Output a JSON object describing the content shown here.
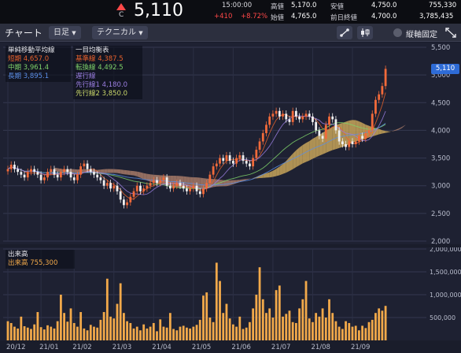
{
  "header": {
    "price_prefix": "C",
    "price": "5,110",
    "time": "15:00:00",
    "change": "+410",
    "change_pct": "+8.72%",
    "stats": [
      {
        "label": "高値",
        "value": "5,170.0"
      },
      {
        "label": "安値",
        "value": "4,750.0"
      },
      {
        "label": "",
        "value": "755,330"
      },
      {
        "label": "始値",
        "value": "4,765.0"
      },
      {
        "label": "前日終値",
        "value": "4,700.0"
      },
      {
        "label": "",
        "value": "3,785,435"
      }
    ]
  },
  "toolbar": {
    "title": "チャート",
    "period": "日足",
    "indicator": "テクニカル",
    "toggle_label": "縦軸固定"
  },
  "legend_sma": {
    "title": "単純移動平均線",
    "items": [
      {
        "name": "短期",
        "value": "4,657.0",
        "color": "#e8612c"
      },
      {
        "name": "中期",
        "value": "3,961.4",
        "color": "#7fd36a"
      },
      {
        "name": "長期",
        "value": "3,895.1",
        "color": "#5b8ee6"
      }
    ]
  },
  "legend_ichimoku": {
    "title": "一目均衡表",
    "items": [
      {
        "name": "基準線",
        "value": "4,387.5",
        "color": "#e8612c"
      },
      {
        "name": "転換線",
        "value": "4,492.5",
        "color": "#7fd36a"
      },
      {
        "name": "遅行線",
        "value": "",
        "color": "#9a7ee0"
      },
      {
        "name": "先行線1",
        "value": "4,180.0",
        "color": "#9a7ee0"
      },
      {
        "name": "先行線2",
        "value": "3,850.0",
        "color": "#c9d76a"
      }
    ]
  },
  "legend_volume": {
    "title": "出来高",
    "items": [
      {
        "name": "出来高",
        "value": "755,300",
        "color": "#f2a94a"
      }
    ]
  },
  "price_axis_labels": [
    "5,500",
    "5,000",
    "4,500",
    "4,000",
    "3,500",
    "3,000",
    "2,500",
    "2,000"
  ],
  "current_price_tag": "5,110",
  "volume_axis_labels": [
    "2,000,000",
    "1,500,000",
    "1,000,000",
    "500,000"
  ],
  "x_axis_labels": [
    "20/12",
    "21/01",
    "21/02",
    "21/03",
    "21/04",
    "21/05",
    "21/06",
    "21/07",
    "21/08",
    "21/09"
  ],
  "colors": {
    "up": "#f26a3a",
    "down": "#f0f0f0",
    "header_change": "#ff4848",
    "cloud_bull": "#c8a45a",
    "cloud_bear": "#a77a68",
    "volume": "#f2a94a"
  },
  "chart_data": [
    {
      "type": "candlestick",
      "title": "",
      "y_axis_ticks": [
        5500,
        5000,
        4500,
        4000,
        3500,
        3000,
        2500,
        2000
      ],
      "ylim": [
        2000,
        5500
      ],
      "x_ticks": [
        "20/12",
        "21/01",
        "21/02",
        "21/03",
        "21/04",
        "21/05",
        "21/06",
        "21/07",
        "21/08",
        "21/09"
      ],
      "close_series": [
        3300,
        3380,
        3300,
        3250,
        3200,
        3150,
        3250,
        3300,
        3250,
        3200,
        3100,
        3150,
        3250,
        3300,
        3200,
        3150,
        3250,
        3300,
        3250,
        3150,
        3100,
        3200,
        3350,
        3400,
        3300,
        3250,
        3200,
        3150,
        3100,
        3000,
        3050,
        2950,
        3000,
        2900,
        2750,
        2650,
        2700,
        2800,
        2900,
        3000,
        2900,
        2950,
        3000,
        3050,
        3100,
        3050,
        3100,
        3150,
        3000,
        2950,
        3000,
        3050,
        3000,
        2950,
        2900,
        2950,
        3000,
        2900,
        2850,
        2950,
        3050,
        3200,
        3350,
        3400,
        3500,
        3450,
        3550,
        3450,
        3400,
        3500,
        3550,
        3450,
        3400,
        3350,
        3500,
        3650,
        3800,
        3950,
        4100,
        4250,
        4300,
        4350,
        4250,
        4300,
        4200,
        4150,
        4350,
        4250,
        4200,
        4250,
        4300,
        4250,
        4150,
        4000,
        3900,
        3850,
        4100,
        4250,
        4200,
        4000,
        3800,
        3750,
        3700,
        3800,
        3750,
        3800,
        3900,
        3850,
        3950,
        4000,
        4300,
        4550,
        4650,
        4800,
        5110
      ],
      "current_price": 5110
    },
    {
      "type": "bar",
      "title": "出来高",
      "y_axis_ticks": [
        2000000,
        1500000,
        1000000,
        500000
      ],
      "ylim": [
        0,
        2000000
      ],
      "last_value": 755300,
      "values": [
        420000,
        380000,
        300000,
        260000,
        520000,
        310000,
        280000,
        250000,
        350000,
        620000,
        290000,
        240000,
        330000,
        300000,
        260000,
        420000,
        1000000,
        600000,
        410000,
        700000,
        380000,
        300000,
        620000,
        260000,
        220000,
        340000,
        300000,
        280000,
        450000,
        620000,
        1350000,
        520000,
        480000,
        800000,
        1250000,
        600000,
        420000,
        380000,
        260000,
        300000,
        220000,
        350000,
        260000,
        300000,
        380000,
        200000,
        460000,
        300000,
        280000,
        600000,
        250000,
        220000,
        300000,
        320000,
        280000,
        260000,
        300000,
        340000,
        450000,
        980000,
        1050000,
        500000,
        400000,
        1700000,
        1300000,
        600000,
        800000,
        480000,
        350000,
        300000,
        520000,
        250000,
        280000,
        400000,
        700000,
        1000000,
        1600000,
        900000,
        600000,
        700000,
        500000,
        1100000,
        1200000,
        520000,
        580000,
        650000,
        400000,
        380000,
        700000,
        900000,
        1300000,
        480000,
        400000,
        600000,
        520000,
        700000,
        500000,
        900000,
        600000,
        420000,
        300000,
        250000,
        420000,
        380000,
        300000,
        320000,
        220000,
        320000,
        270000,
        400000,
        450000,
        600000,
        700000,
        650000,
        755300
      ]
    }
  ]
}
